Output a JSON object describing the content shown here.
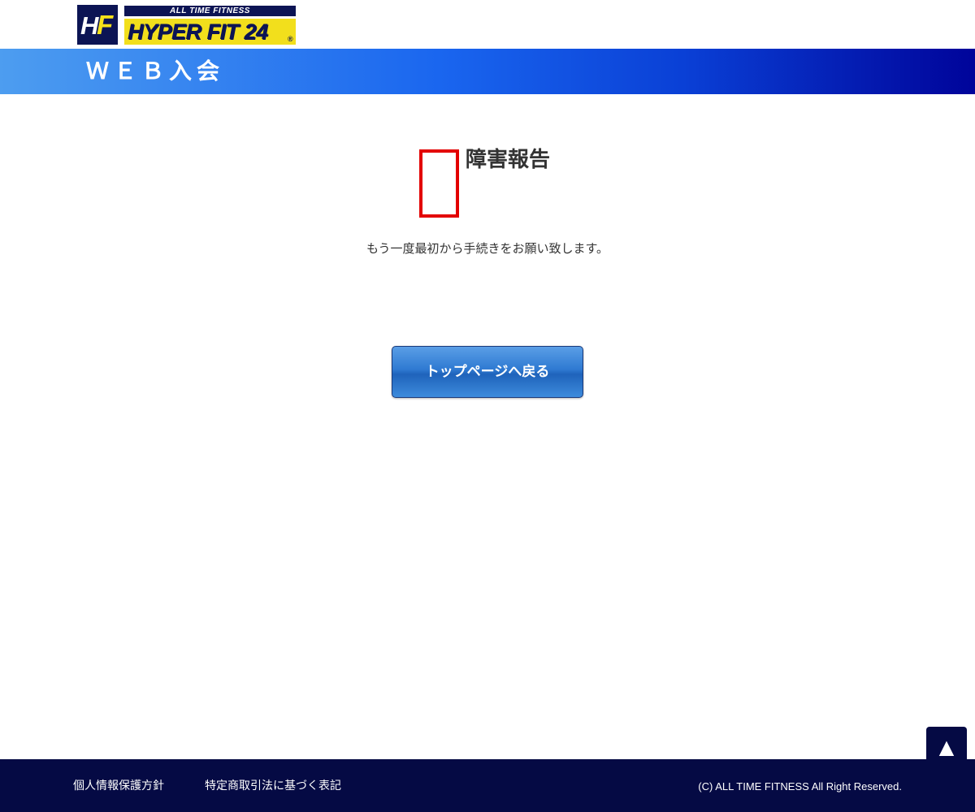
{
  "logo": {
    "mark_h": "H",
    "mark_f": "F",
    "tagline": "ALL TIME FITNESS",
    "name": "HYPER FIT 24",
    "registered": "®"
  },
  "header": {
    "title": "ＷＥＢ入会"
  },
  "main": {
    "error_icon": "warning-icon",
    "title": "障害報告",
    "message": "もう一度最初から手続きをお願い致します。",
    "top_button_label": "トップページへ戻る"
  },
  "page_top": {
    "icon": "arrow-up-icon",
    "glyph": "▲"
  },
  "footer": {
    "links": [
      {
        "label": "個人情報保護方針"
      },
      {
        "label": "特定商取引法に基づく表記"
      }
    ],
    "copyright": "(C) ALL TIME FITNESS All Right Reserved."
  },
  "colors": {
    "navy": "#050a44",
    "band_start": "#4d9df0",
    "band_end": "#00049a",
    "logo_yellow": "#f2df1c",
    "error_red": "#e30000",
    "button_blue": "#2f7ad2"
  }
}
